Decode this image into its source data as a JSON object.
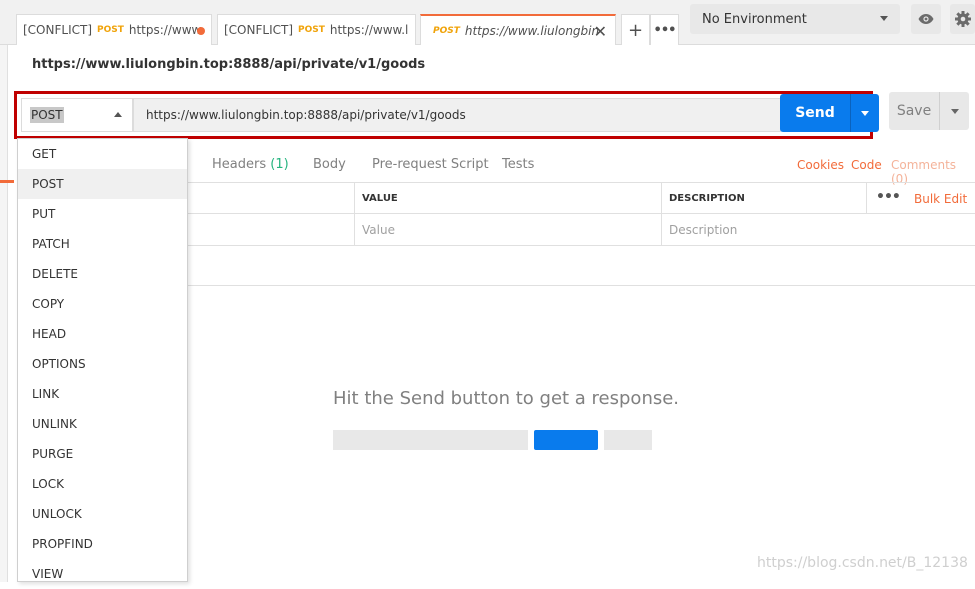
{
  "tabs": [
    {
      "prefix": "[CONFLICT]",
      "method": "POST",
      "url": "https://www.liu"
    },
    {
      "prefix": "[CONFLICT]",
      "method": "POST",
      "url": "https://www.liulon"
    },
    {
      "prefix": "",
      "method": "POST",
      "url": "https://www.liulongbin.top"
    }
  ],
  "environment": {
    "selected": "No Environment"
  },
  "request": {
    "name": "https://www.liulongbin.top:8888/api/private/v1/goods",
    "method": "POST",
    "url": "https://www.liulongbin.top:8888/api/private/v1/goods",
    "send_label": "Send",
    "save_label": "Save"
  },
  "subtabs": {
    "headers": "Headers",
    "headers_count": "(1)",
    "body": "Body",
    "prerequest": "Pre-request Script",
    "tests": "Tests",
    "cookies": "Cookies",
    "code": "Code",
    "comments": "Comments (0)"
  },
  "kv": {
    "col_value": "VALUE",
    "col_description": "DESCRIPTION",
    "bulk_edit": "Bulk Edit",
    "value_placeholder": "Value",
    "description_placeholder": "Description"
  },
  "method_dropdown": {
    "items": [
      "GET",
      "POST",
      "PUT",
      "PATCH",
      "DELETE",
      "COPY",
      "HEAD",
      "OPTIONS",
      "LINK",
      "UNLINK",
      "PURGE",
      "LOCK",
      "UNLOCK",
      "PROPFIND",
      "VIEW"
    ],
    "selected": "POST"
  },
  "response": {
    "hint": "Hit the Send button to get a response."
  },
  "watermark": "https://blog.csdn.net/B_12138",
  "colors": {
    "accent": "#f26b3a",
    "send": "#097bed",
    "highlight_border": "#c00000",
    "method_post": "#f0a30a"
  }
}
